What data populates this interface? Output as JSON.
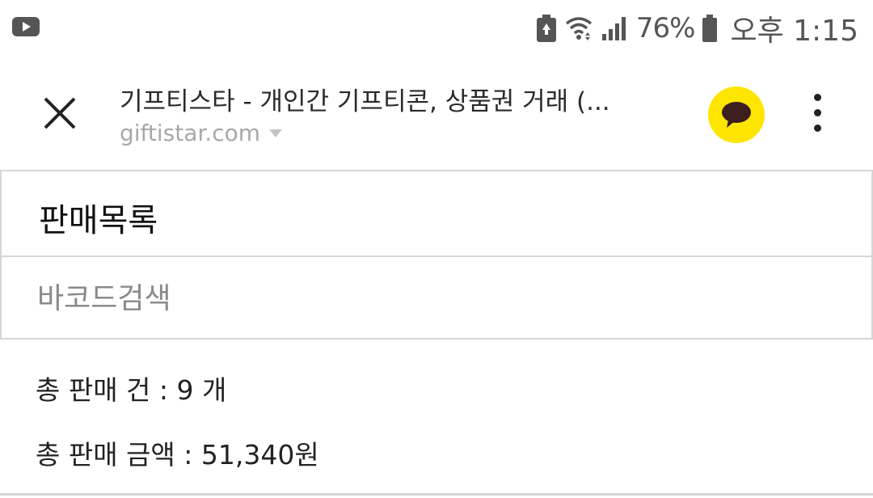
{
  "status_bar": {
    "battery_percent": "76%",
    "time": "오후 1:15",
    "icons": [
      "youtube-icon",
      "battery-saver-icon",
      "wifi-icon",
      "signal-icon",
      "battery-icon"
    ]
  },
  "header": {
    "title": "기프티스타 - 개인간 기프티콘, 상품권 거래 (...",
    "url": "giftistar.com",
    "close_icon": "close-icon",
    "share_icon": "kakaotalk-icon",
    "menu_icon": "more-vert-icon",
    "kakao_color": "#fee500"
  },
  "page": {
    "section_title": "판매목록",
    "search": {
      "placeholder": "바코드검색",
      "value": ""
    },
    "summary": {
      "count_label": "총 판매 건 : ",
      "count_value": "9 개",
      "amount_label": "총 판매 금액 : ",
      "amount_value": "51,340원"
    }
  }
}
